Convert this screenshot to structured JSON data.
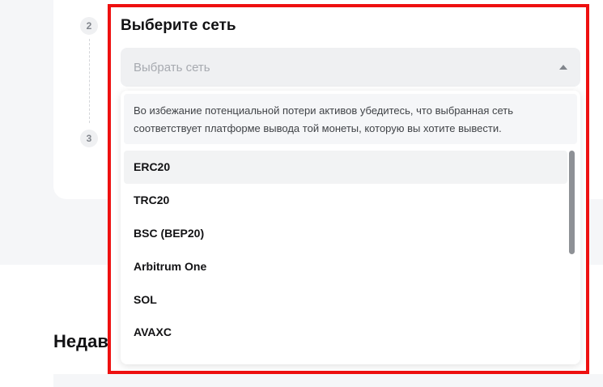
{
  "steps": [
    "2",
    "3"
  ],
  "section_heading": "Недавн",
  "network_panel": {
    "title": "Выберите сеть",
    "select": {
      "placeholder": "Выбрать сеть"
    },
    "notice": "Во избежание потенциальной потери активов убедитесь, что выбранная сеть соответствует платформе вывода той монеты, которую вы хотите вывести.",
    "options": [
      "ERC20",
      "TRC20",
      "BSC (BEP20)",
      "Arbitrum One",
      "SOL",
      "AVAXC"
    ],
    "hovered_option": "ERC20"
  },
  "colors": {
    "highlight_border": "#ee1010",
    "select_bg": "#eff0f2",
    "page_bg": "#f5f6f8"
  },
  "icons": {
    "select_caret": "caret-up-icon"
  }
}
